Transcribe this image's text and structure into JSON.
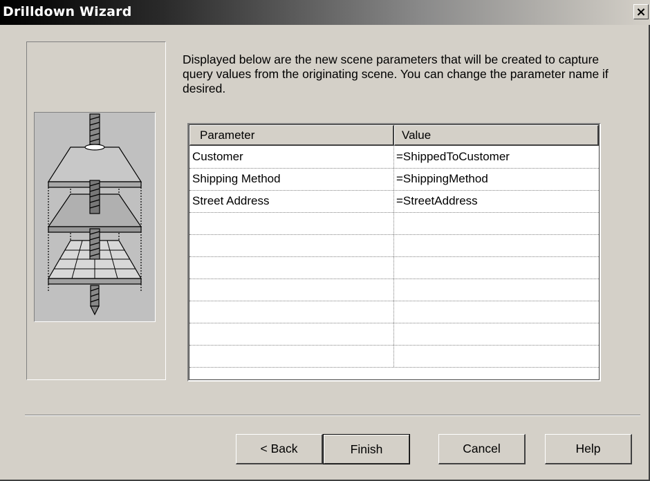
{
  "window": {
    "title": "Drilldown Wizard",
    "close_label": "✕"
  },
  "intro_text": "Displayed below are the new scene parameters that will be created to capture query values from the originating scene. You can change the parameter name if desired.",
  "grid": {
    "columns": [
      "Parameter",
      "Value"
    ],
    "rows": [
      {
        "parameter": "Customer",
        "value": "=ShippedToCustomer"
      },
      {
        "parameter": "Shipping Method",
        "value": "=ShippingMethod"
      },
      {
        "parameter": "Street Address",
        "value": "=StreetAddress"
      },
      {
        "parameter": "",
        "value": ""
      },
      {
        "parameter": "",
        "value": ""
      },
      {
        "parameter": "",
        "value": ""
      },
      {
        "parameter": "",
        "value": ""
      },
      {
        "parameter": "",
        "value": ""
      },
      {
        "parameter": "",
        "value": ""
      },
      {
        "parameter": "",
        "value": ""
      }
    ]
  },
  "buttons": {
    "back": "< Back",
    "finish": "Finish",
    "cancel": "Cancel",
    "help": "Help"
  },
  "illustration": {
    "icon": "drill-layers-icon"
  }
}
